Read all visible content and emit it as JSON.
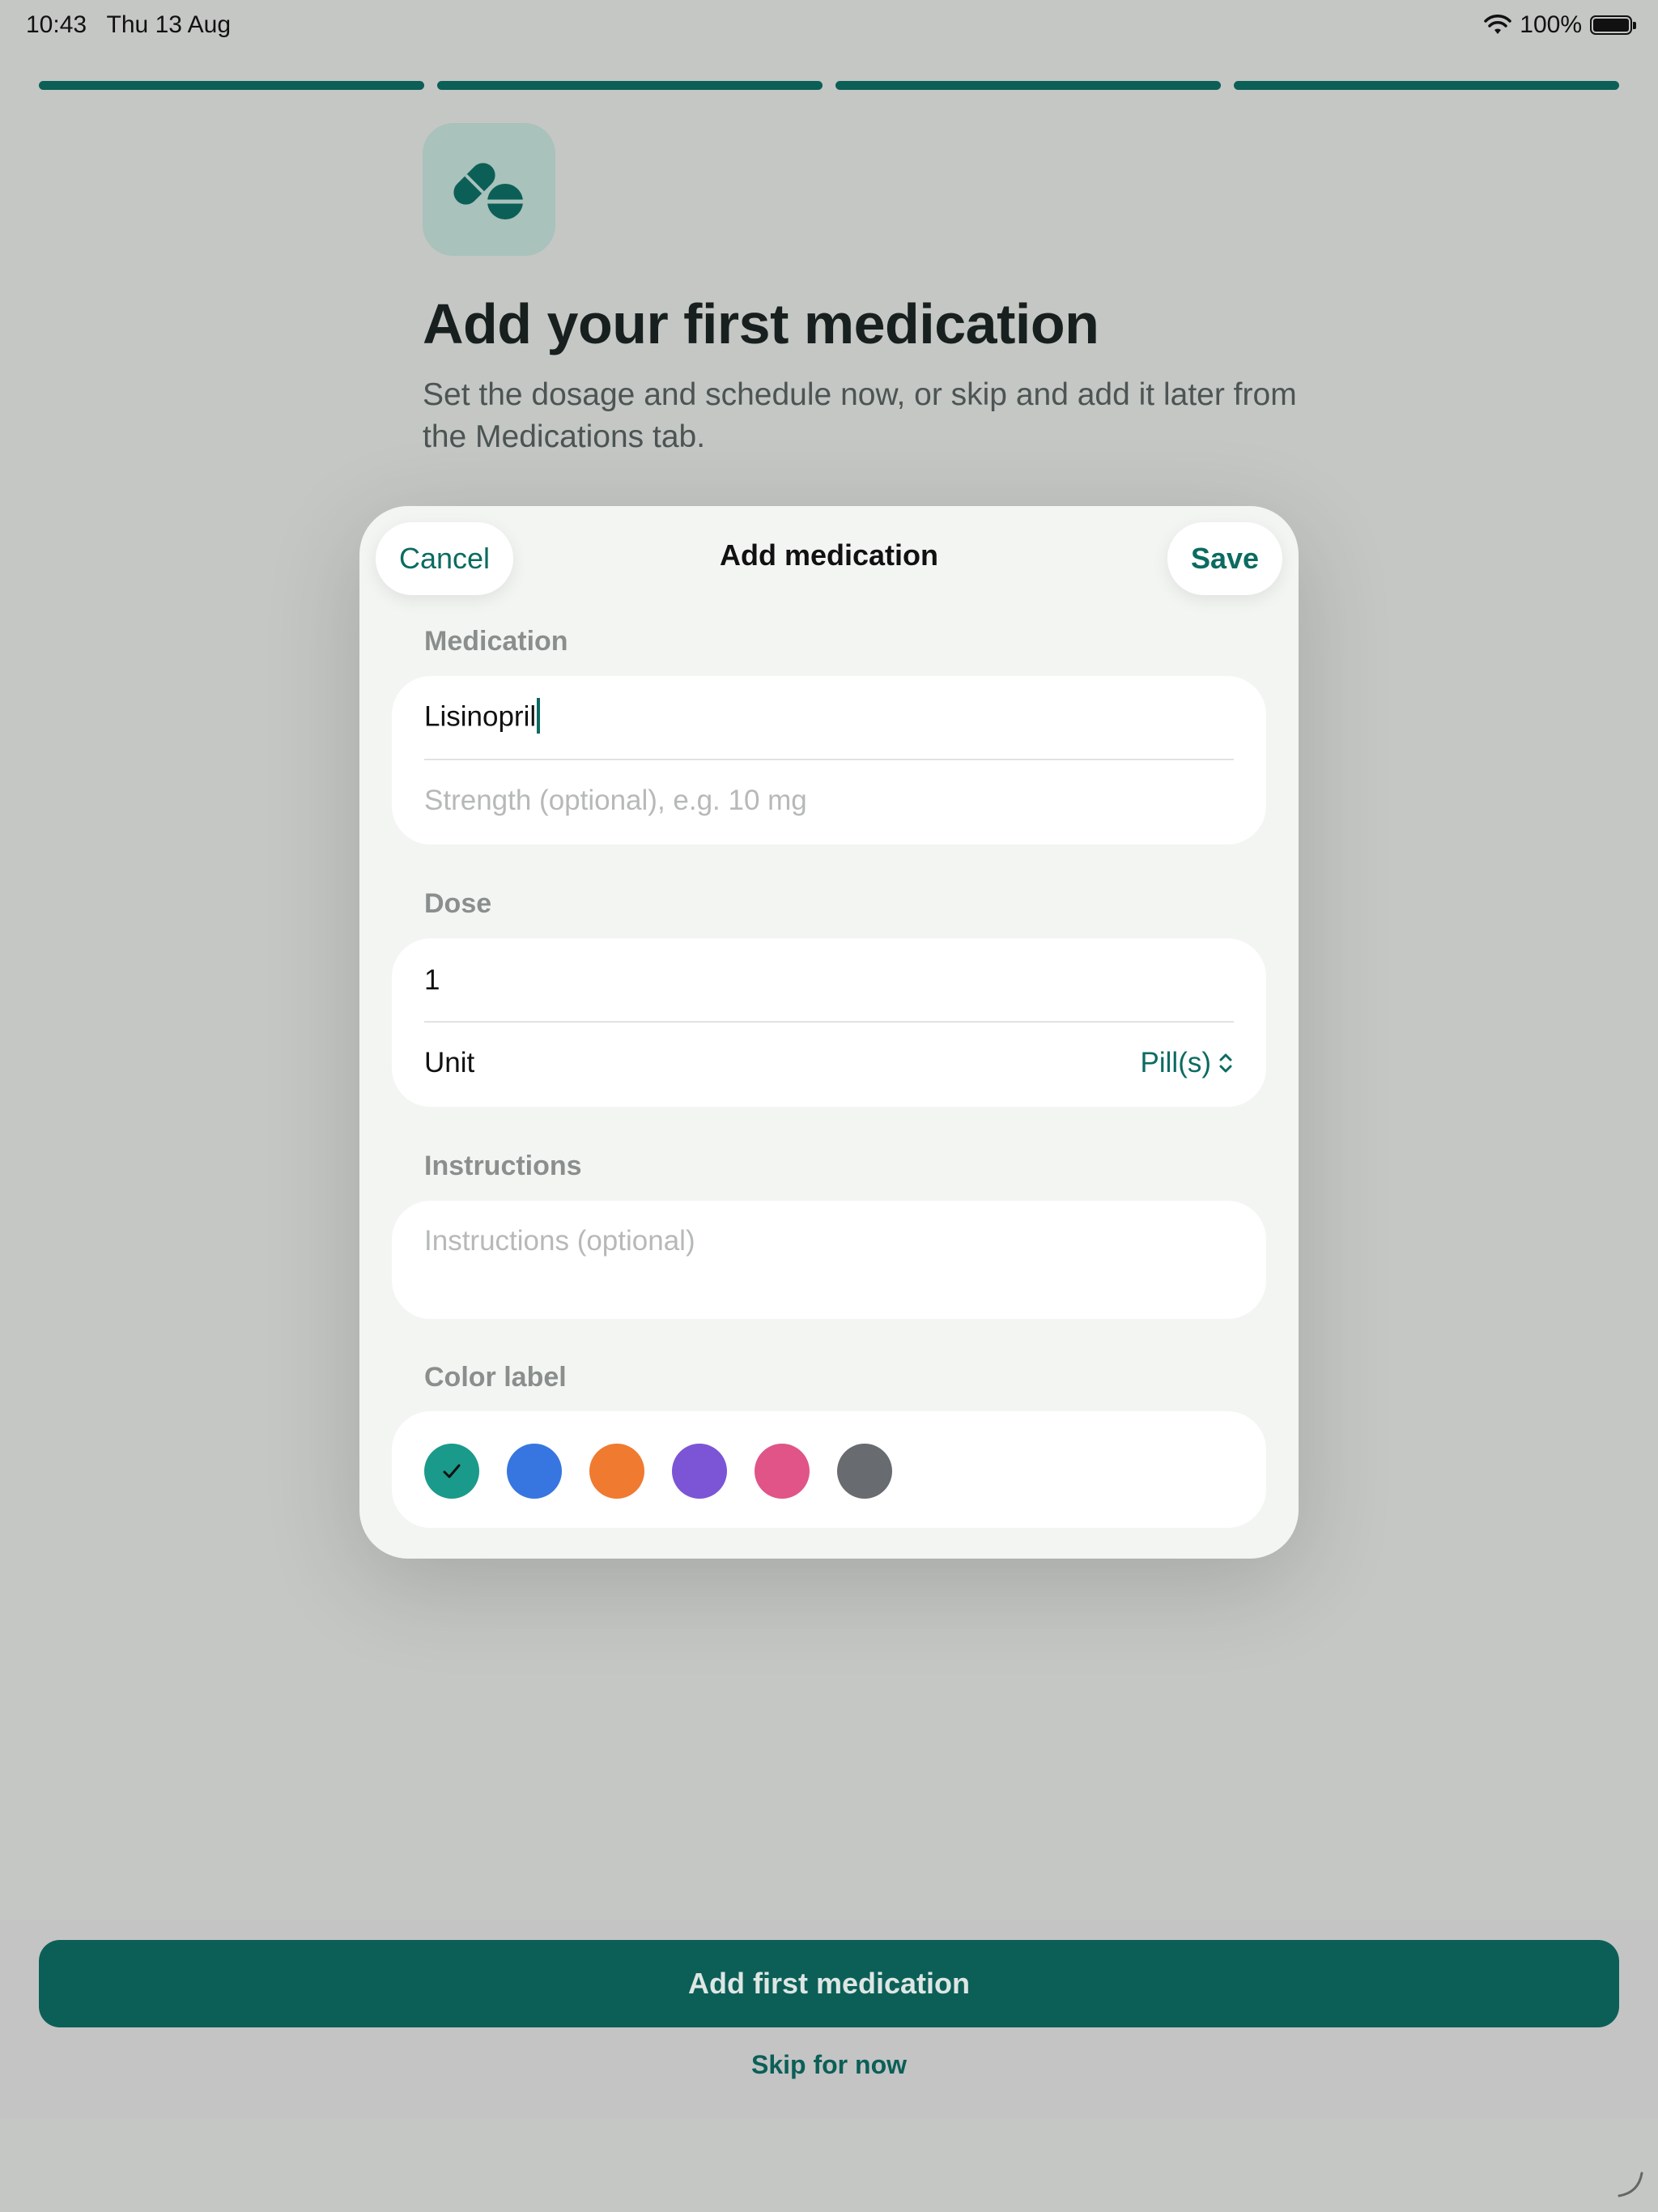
{
  "status_bar": {
    "time": "10:43",
    "date": "Thu 13 Aug",
    "battery": "100%"
  },
  "progress": {
    "segments_total": 4,
    "segments_complete": 4
  },
  "header": {
    "icon": "pills-icon",
    "title": "Add your first medication",
    "subtitle": "Set the dosage and schedule now, or skip and add it later from the Medications tab."
  },
  "modal": {
    "cancel_label": "Cancel",
    "title": "Add medication",
    "save_label": "Save",
    "medication": {
      "section_label": "Medication",
      "name_value": "Lisinopril",
      "strength_placeholder": "Strength (optional), e.g. 10 mg"
    },
    "dose": {
      "section_label": "Dose",
      "amount_value": "1",
      "unit_label": "Unit",
      "unit_value": "Pill(s)"
    },
    "instructions": {
      "section_label": "Instructions",
      "placeholder": "Instructions (optional)"
    },
    "color_label": {
      "section_label": "Color label",
      "selected_index": 0,
      "colors": [
        "#1a9a8a",
        "#3776e0",
        "#ef7a30",
        "#7c55d6",
        "#e05487",
        "#686c70"
      ]
    }
  },
  "footer": {
    "primary_label": "Add first medication",
    "skip_label": "Skip for now"
  },
  "colors": {
    "accent": "#0b5f57",
    "link": "#0b6b61"
  }
}
